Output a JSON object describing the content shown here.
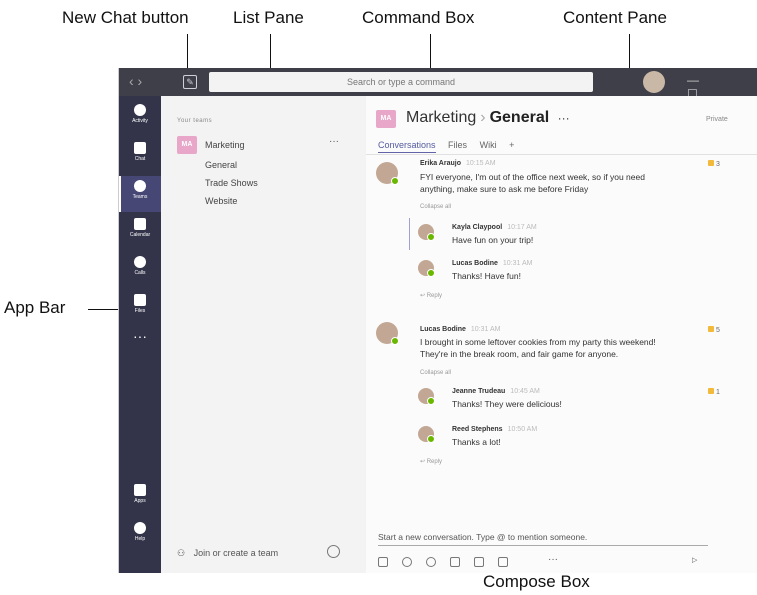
{
  "callouts": {
    "new_chat": "New Chat button",
    "list_pane": "List Pane",
    "command_box": "Command Box",
    "content_pane": "Content Pane",
    "app_bar": "App Bar",
    "compose_box": "Compose Box"
  },
  "titlebar": {
    "nav": "‹  ›",
    "search_placeholder": "Search or type a command",
    "win_controls": "— ☐ ✕"
  },
  "appbar": {
    "items": [
      {
        "label": "Activity"
      },
      {
        "label": "Chat"
      },
      {
        "label": "Teams"
      },
      {
        "label": "Calendar"
      },
      {
        "label": "Calls"
      },
      {
        "label": "Files"
      }
    ],
    "more": "···",
    "bottom": [
      {
        "label": "Apps"
      },
      {
        "label": "Help"
      }
    ]
  },
  "list": {
    "heading": "Your teams",
    "team": {
      "initials": "MA",
      "name": "Marketing",
      "more": "···"
    },
    "channels": [
      "General",
      "Trade Shows",
      "Website"
    ],
    "join": "Join or create a team"
  },
  "channel": {
    "initials": "MA",
    "team": "Marketing",
    "sep": "›",
    "name": "General",
    "more": "···",
    "privacy": "Private",
    "tabs": [
      "Conversations",
      "Files",
      "Wiki",
      "+"
    ]
  },
  "conversation": [
    {
      "author": "Erika Araujo",
      "time": "10:15 AM",
      "lines": [
        "FYI everyone, I'm out of the office next week, so if you need",
        "anything, make sure to ask me before Friday"
      ],
      "likes": "3",
      "collapse": "Collapse all",
      "replies": [
        {
          "author": "Kayla Claypool",
          "time": "10:17 AM",
          "text": "Have fun on your trip!"
        },
        {
          "author": "Lucas Bodine",
          "time": "10:31 AM",
          "text": "Thanks! Have fun!"
        }
      ],
      "reply": "Reply"
    },
    {
      "author": "Lucas Bodine",
      "time": "10:31 AM",
      "lines": [
        "I brought in some leftover cookies from my party this weekend!",
        "They're in the break room, and fair game for anyone."
      ],
      "likes": "5",
      "collapse": "Collapse all",
      "replies": [
        {
          "author": "Jeanne Trudeau",
          "time": "10:45 AM",
          "text": "Thanks! They were delicious!",
          "likes": "1"
        },
        {
          "author": "Reed Stephens",
          "time": "10:50 AM",
          "text": "Thanks a lot!"
        }
      ],
      "reply": "Reply"
    }
  ],
  "compose": {
    "placeholder": "Start a new conversation. Type @ to mention someone.",
    "more": "···",
    "send": "▷"
  }
}
